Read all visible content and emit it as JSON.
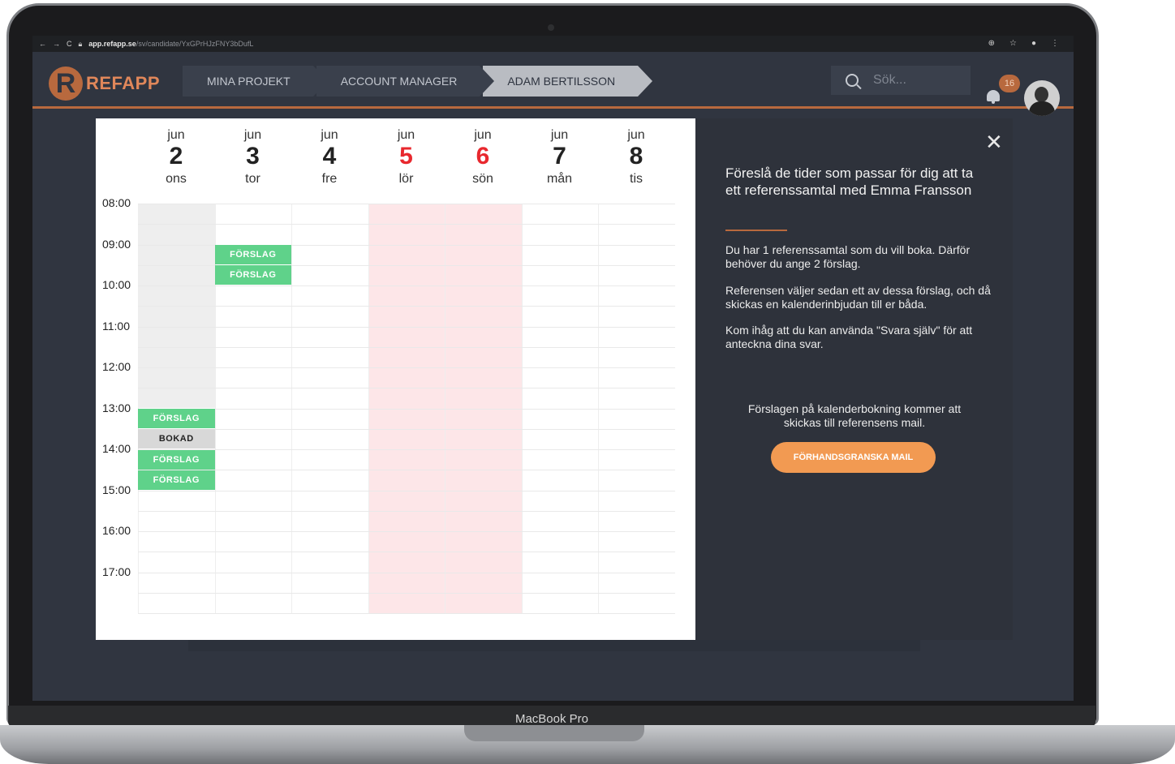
{
  "device_label": "MacBook Pro",
  "browser": {
    "url_host": "app.refapp.se",
    "url_path": "/sv/candidate/YxGPrHJzFNY3bDufL"
  },
  "app": {
    "logo_text": "REFAPP",
    "breadcrumbs": [
      "MINA PROJEKT",
      "ACCOUNT MANAGER",
      "ADAM BERTILSSON"
    ],
    "search_placeholder": "Sök...",
    "notification_count": "16",
    "accent_color": "#b8693e"
  },
  "calendar": {
    "days": [
      {
        "month": "jun",
        "day": "2",
        "weekday": "ons",
        "weekend": false
      },
      {
        "month": "jun",
        "day": "3",
        "weekday": "tor",
        "weekend": false
      },
      {
        "month": "jun",
        "day": "4",
        "weekday": "fre",
        "weekend": false
      },
      {
        "month": "jun",
        "day": "5",
        "weekday": "lör",
        "weekend": true
      },
      {
        "month": "jun",
        "day": "6",
        "weekday": "sön",
        "weekend": true
      },
      {
        "month": "jun",
        "day": "7",
        "weekday": "mån",
        "weekend": false
      },
      {
        "month": "jun",
        "day": "8",
        "weekday": "tis",
        "weekend": false
      }
    ],
    "hours": [
      "08:00",
      "09:00",
      "10:00",
      "11:00",
      "12:00",
      "13:00",
      "14:00",
      "15:00",
      "16:00",
      "17:00"
    ],
    "events": [
      {
        "day_index": 1,
        "start": "09:00",
        "label": "FÖRSLAG",
        "kind": "suggestion"
      },
      {
        "day_index": 1,
        "start": "09:30",
        "label": "FÖRSLAG",
        "kind": "suggestion"
      },
      {
        "day_index": 0,
        "start": "13:00",
        "label": "FÖRSLAG",
        "kind": "suggestion"
      },
      {
        "day_index": 0,
        "start": "13:30",
        "label": "BOKAD",
        "kind": "booked"
      },
      {
        "day_index": 0,
        "start": "14:00",
        "label": "FÖRSLAG",
        "kind": "suggestion"
      },
      {
        "day_index": 0,
        "start": "14:30",
        "label": "FÖRSLAG",
        "kind": "suggestion"
      }
    ]
  },
  "side_panel": {
    "title": "Föreslå de tider som passar för dig att ta ett referenssamtal med Emma Fransson",
    "paragraph_1": "Du har 1 referenssamtal som du vill boka. Därför behöver du ange 2 förslag.",
    "paragraph_2": "Referensen väljer sedan ett av dessa förslag, och då skickas en kalenderinbjudan till er båda.",
    "paragraph_3": "Kom ihåg att du kan använda \"Svara själv\" för att anteckna dina svar.",
    "note": "Förslagen på kalenderbokning kommer att skickas till referensens mail.",
    "preview_button": "FÖRHANDSGRANSKA MAIL",
    "close_symbol": "✕"
  }
}
